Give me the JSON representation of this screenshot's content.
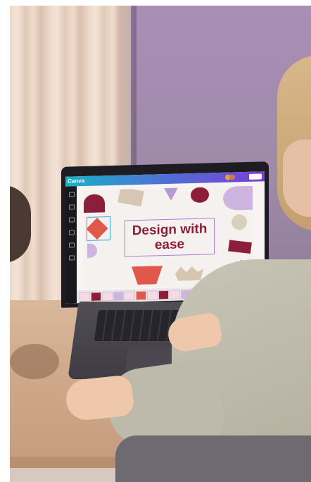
{
  "screen": {
    "app_logo": "Canva",
    "design_title": "Design with ease",
    "colors": {
      "brand_gradient_start": "#19b2c7",
      "brand_gradient_end": "#7a3fd8",
      "title_color": "#8b1f3a"
    }
  },
  "icons": [
    "share-icon",
    "avatar-icon",
    "rail-icon"
  ]
}
